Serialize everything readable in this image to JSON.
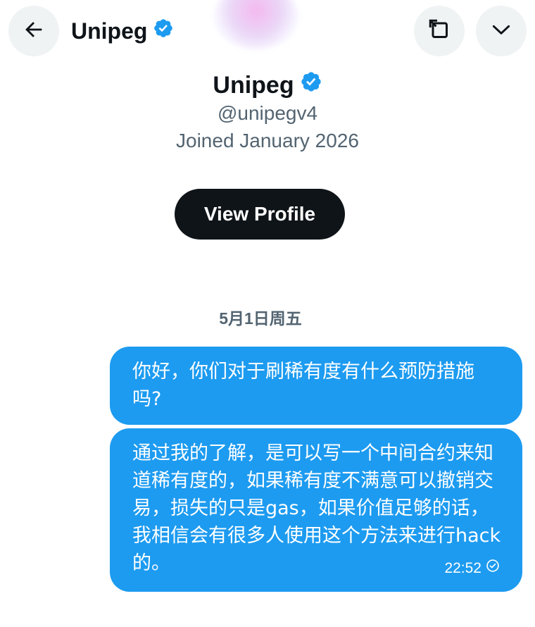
{
  "header": {
    "name": "Unipeg"
  },
  "profile": {
    "name": "Unipeg",
    "handle": "@unipegv4",
    "joined": "Joined January 2026",
    "view_profile_label": "View Profile"
  },
  "conversation": {
    "date_separator": "5月1日周五",
    "messages": [
      {
        "text": "你好，你们对于刷稀有度有什么预防措施吗?"
      },
      {
        "text": "通过我的了解，是可以写一个中间合约来知道稀有度的，如果稀有度不满意可以撤销交易，损失的只是gas，如果价值足够的话，我相信会有很多人使用这个方法来进行hack的。",
        "time": "22:52",
        "status_icon": "sent-check-icon"
      }
    ]
  },
  "icons": {
    "back": "arrow-left-icon",
    "expand": "expand-icon",
    "more": "chevron-down-icon",
    "verified": "verified-badge-icon"
  },
  "colors": {
    "accent": "#1d9bf0",
    "primary_button": "#0f1419",
    "icon_button_bg": "#eff3f4",
    "secondary_text": "#536471"
  }
}
